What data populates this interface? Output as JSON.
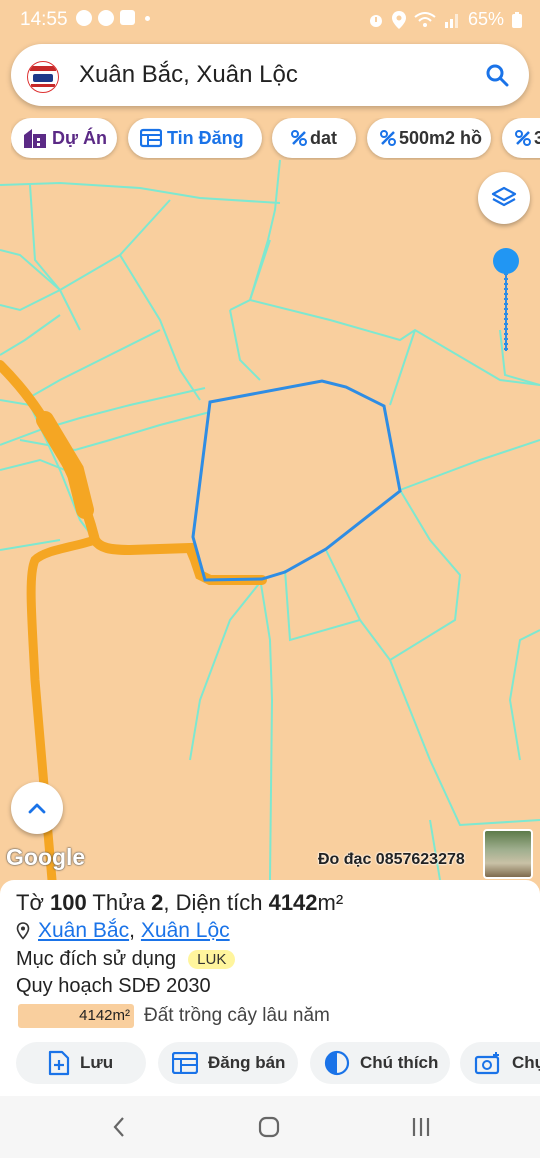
{
  "status_bar": {
    "time": "14:55",
    "battery": "65%",
    "icons": [
      "messenger-icon",
      "messenger-icon",
      "shopee-icon",
      "dot",
      "alarm-icon",
      "location-icon",
      "wifi-icon",
      "signal-icon",
      "battery-icon"
    ]
  },
  "search": {
    "text": "Xuân Bắc, Xuân Lộc"
  },
  "chips": [
    {
      "label": "Dự Án",
      "icon": "building-icon",
      "color": "#5b2a86"
    },
    {
      "label": "Tin Đăng",
      "icon": "listing-icon",
      "color": "#1a73e8"
    },
    {
      "label": "dat",
      "icon": "percent-tag-icon",
      "color": "#1a73e8"
    },
    {
      "label": "500m2 hồ",
      "icon": "percent-tag-icon",
      "color": "#1a73e8"
    },
    {
      "label": "3",
      "icon": "percent-tag-icon",
      "color": "#1a73e8"
    }
  ],
  "map": {
    "google_label": "Google",
    "survey_text": "Đo đạc 0857623278",
    "background_color": "#f9cf9e",
    "parcel_line_color": "#7ee8d0",
    "selected_outline_color": "#2f8de4",
    "road_color": "#f5a623"
  },
  "info": {
    "title_prefix": "Tờ ",
    "sheet": "100",
    "title_mid": " Thửa ",
    "parcel": "2",
    "title_area_label": ", Diện tích ",
    "area": "4142",
    "unit": "m²",
    "locality": "Xuân Bắc",
    "district": "Xuân Lộc",
    "separator": ",",
    "purpose_label": "Mục đích sử dụng",
    "purpose_code": "LUK",
    "plan_label": "Quy hoạch SDĐ 2030",
    "plan_area": "4142m²",
    "plan_desc": "Đất trồng cây lâu năm"
  },
  "actions": [
    {
      "label": "Lưu",
      "icon": "file-add-icon"
    },
    {
      "label": "Đăng bán",
      "icon": "listing-icon"
    },
    {
      "label": "Chú thích",
      "icon": "contrast-icon"
    },
    {
      "label": "Chụ",
      "icon": "camera-add-icon"
    }
  ]
}
